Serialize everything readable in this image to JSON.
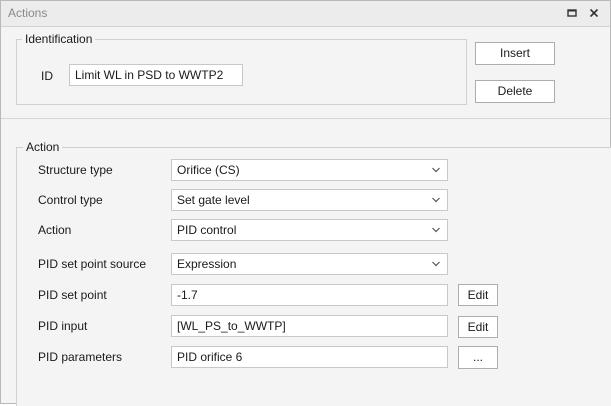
{
  "window": {
    "title": "Actions"
  },
  "identification": {
    "legend": "Identification",
    "id_label": "ID",
    "id_value": "Limit WL in PSD to WWTP2"
  },
  "buttons": {
    "insert": "Insert",
    "delete": "Delete"
  },
  "action": {
    "legend": "Action",
    "structure_type_label": "Structure type",
    "structure_type_value": "Orifice (CS)",
    "control_type_label": "Control type",
    "control_type_value": "Set gate level",
    "action_label": "Action",
    "action_value": "PID control",
    "pid_sps_label": "PID set point source",
    "pid_sps_value": "Expression",
    "pid_sp_label": "PID set point",
    "pid_sp_value": "-1.7",
    "pid_sp_edit": "Edit",
    "pid_input_label": "PID input",
    "pid_input_value": "[WL_PS_to_WWTP]",
    "pid_input_edit": "Edit",
    "pid_params_label": "PID parameters",
    "pid_params_value": "PID orifice 6",
    "pid_params_browse": "..."
  },
  "icons": {
    "restore": "restore-icon",
    "close": "close-icon",
    "dropdown": "chevron-down-icon"
  }
}
